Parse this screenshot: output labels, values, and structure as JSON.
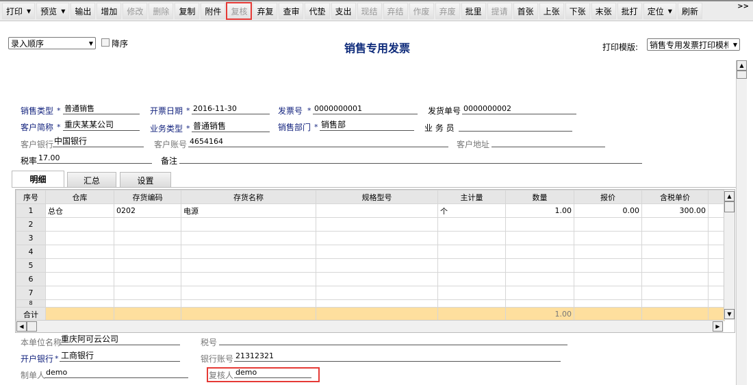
{
  "toolbar": {
    "items": [
      {
        "label": "打印",
        "enabled": true,
        "dropdown": true
      },
      {
        "label": "预览",
        "enabled": true,
        "dropdown": true
      },
      {
        "label": "输出",
        "enabled": true
      },
      {
        "label": "增加",
        "enabled": true
      },
      {
        "label": "修改",
        "enabled": false
      },
      {
        "label": "删除",
        "enabled": false
      },
      {
        "label": "复制",
        "enabled": true
      },
      {
        "label": "附件",
        "enabled": true
      },
      {
        "label": "复核",
        "enabled": false,
        "highlighted": true
      },
      {
        "label": "弃复",
        "enabled": true
      },
      {
        "label": "查审",
        "enabled": true
      },
      {
        "label": "代垫",
        "enabled": true
      },
      {
        "label": "支出",
        "enabled": true
      },
      {
        "label": "现结",
        "enabled": false
      },
      {
        "label": "弃结",
        "enabled": false
      },
      {
        "label": "作废",
        "enabled": false
      },
      {
        "label": "弃废",
        "enabled": false
      },
      {
        "label": "批里",
        "enabled": true
      },
      {
        "label": "提请",
        "enabled": false
      },
      {
        "label": "首张",
        "enabled": true
      },
      {
        "label": "上张",
        "enabled": true
      },
      {
        "label": "下张",
        "enabled": true
      },
      {
        "label": "末张",
        "enabled": true
      },
      {
        "label": "批打",
        "enabled": true
      },
      {
        "label": "定位",
        "enabled": true,
        "dropdown": true
      },
      {
        "label": "刷新",
        "enabled": true
      }
    ],
    "more": ">>"
  },
  "sort": {
    "value": "录入顺序",
    "desc_label": "降序",
    "desc_checked": false
  },
  "title": "销售专用发票",
  "print_template": {
    "label": "打印模版:",
    "value": "销售专用发票打印模札"
  },
  "header": {
    "sale_type": {
      "label": "销售类型",
      "value": "普通销售"
    },
    "invoice_date": {
      "label": "开票日期",
      "value": "2016-11-30"
    },
    "invoice_no": {
      "label": "发票号",
      "value": "0000000001"
    },
    "delivery_no": {
      "label": "发货单号",
      "value": "0000000002"
    },
    "customer": {
      "label": "客户简称",
      "value": "重庆某某公司"
    },
    "biz_type": {
      "label": "业务类型",
      "value": "普通销售"
    },
    "dept": {
      "label": "销售部门",
      "value": "销售部"
    },
    "salesman": {
      "label": "业 务 员",
      "value": ""
    },
    "cust_bank": {
      "label": "客户银行",
      "value": "中国银行"
    },
    "cust_account": {
      "label": "客户账号",
      "value": "4654164"
    },
    "cust_address": {
      "label": "客户地址",
      "value": ""
    },
    "tax_rate": {
      "label": "税率",
      "value": "17.00"
    },
    "remark": {
      "label": "备注",
      "value": ""
    },
    "required_mark": "*"
  },
  "tabs": [
    "明细",
    "汇总",
    "设置"
  ],
  "grid": {
    "columns": [
      "序号",
      "仓库",
      "存货编码",
      "存货名称",
      "规格型号",
      "主计量",
      "数量",
      "报价",
      "含税单价"
    ],
    "rows": [
      [
        "1",
        "总仓",
        "0202",
        "电源",
        "",
        "个",
        "1.00",
        "0.00",
        "300.00"
      ],
      [
        "2"
      ],
      [
        "3"
      ],
      [
        "4"
      ],
      [
        "5"
      ],
      [
        "6"
      ],
      [
        "7"
      ],
      [
        "8"
      ]
    ],
    "total_label": "合计",
    "total_qty": "1.00"
  },
  "footer": {
    "company": {
      "label": "本单位名称",
      "value": "重庆阿可云公司"
    },
    "tax_no": {
      "label": "税号",
      "value": ""
    },
    "bank": {
      "label": "开户银行",
      "value": "工商银行"
    },
    "bank_account": {
      "label": "银行账号",
      "value": "21312321"
    },
    "maker": {
      "label": "制单人",
      "value": "demo"
    },
    "reviewer": {
      "label": "复核人",
      "value": "demo"
    }
  }
}
